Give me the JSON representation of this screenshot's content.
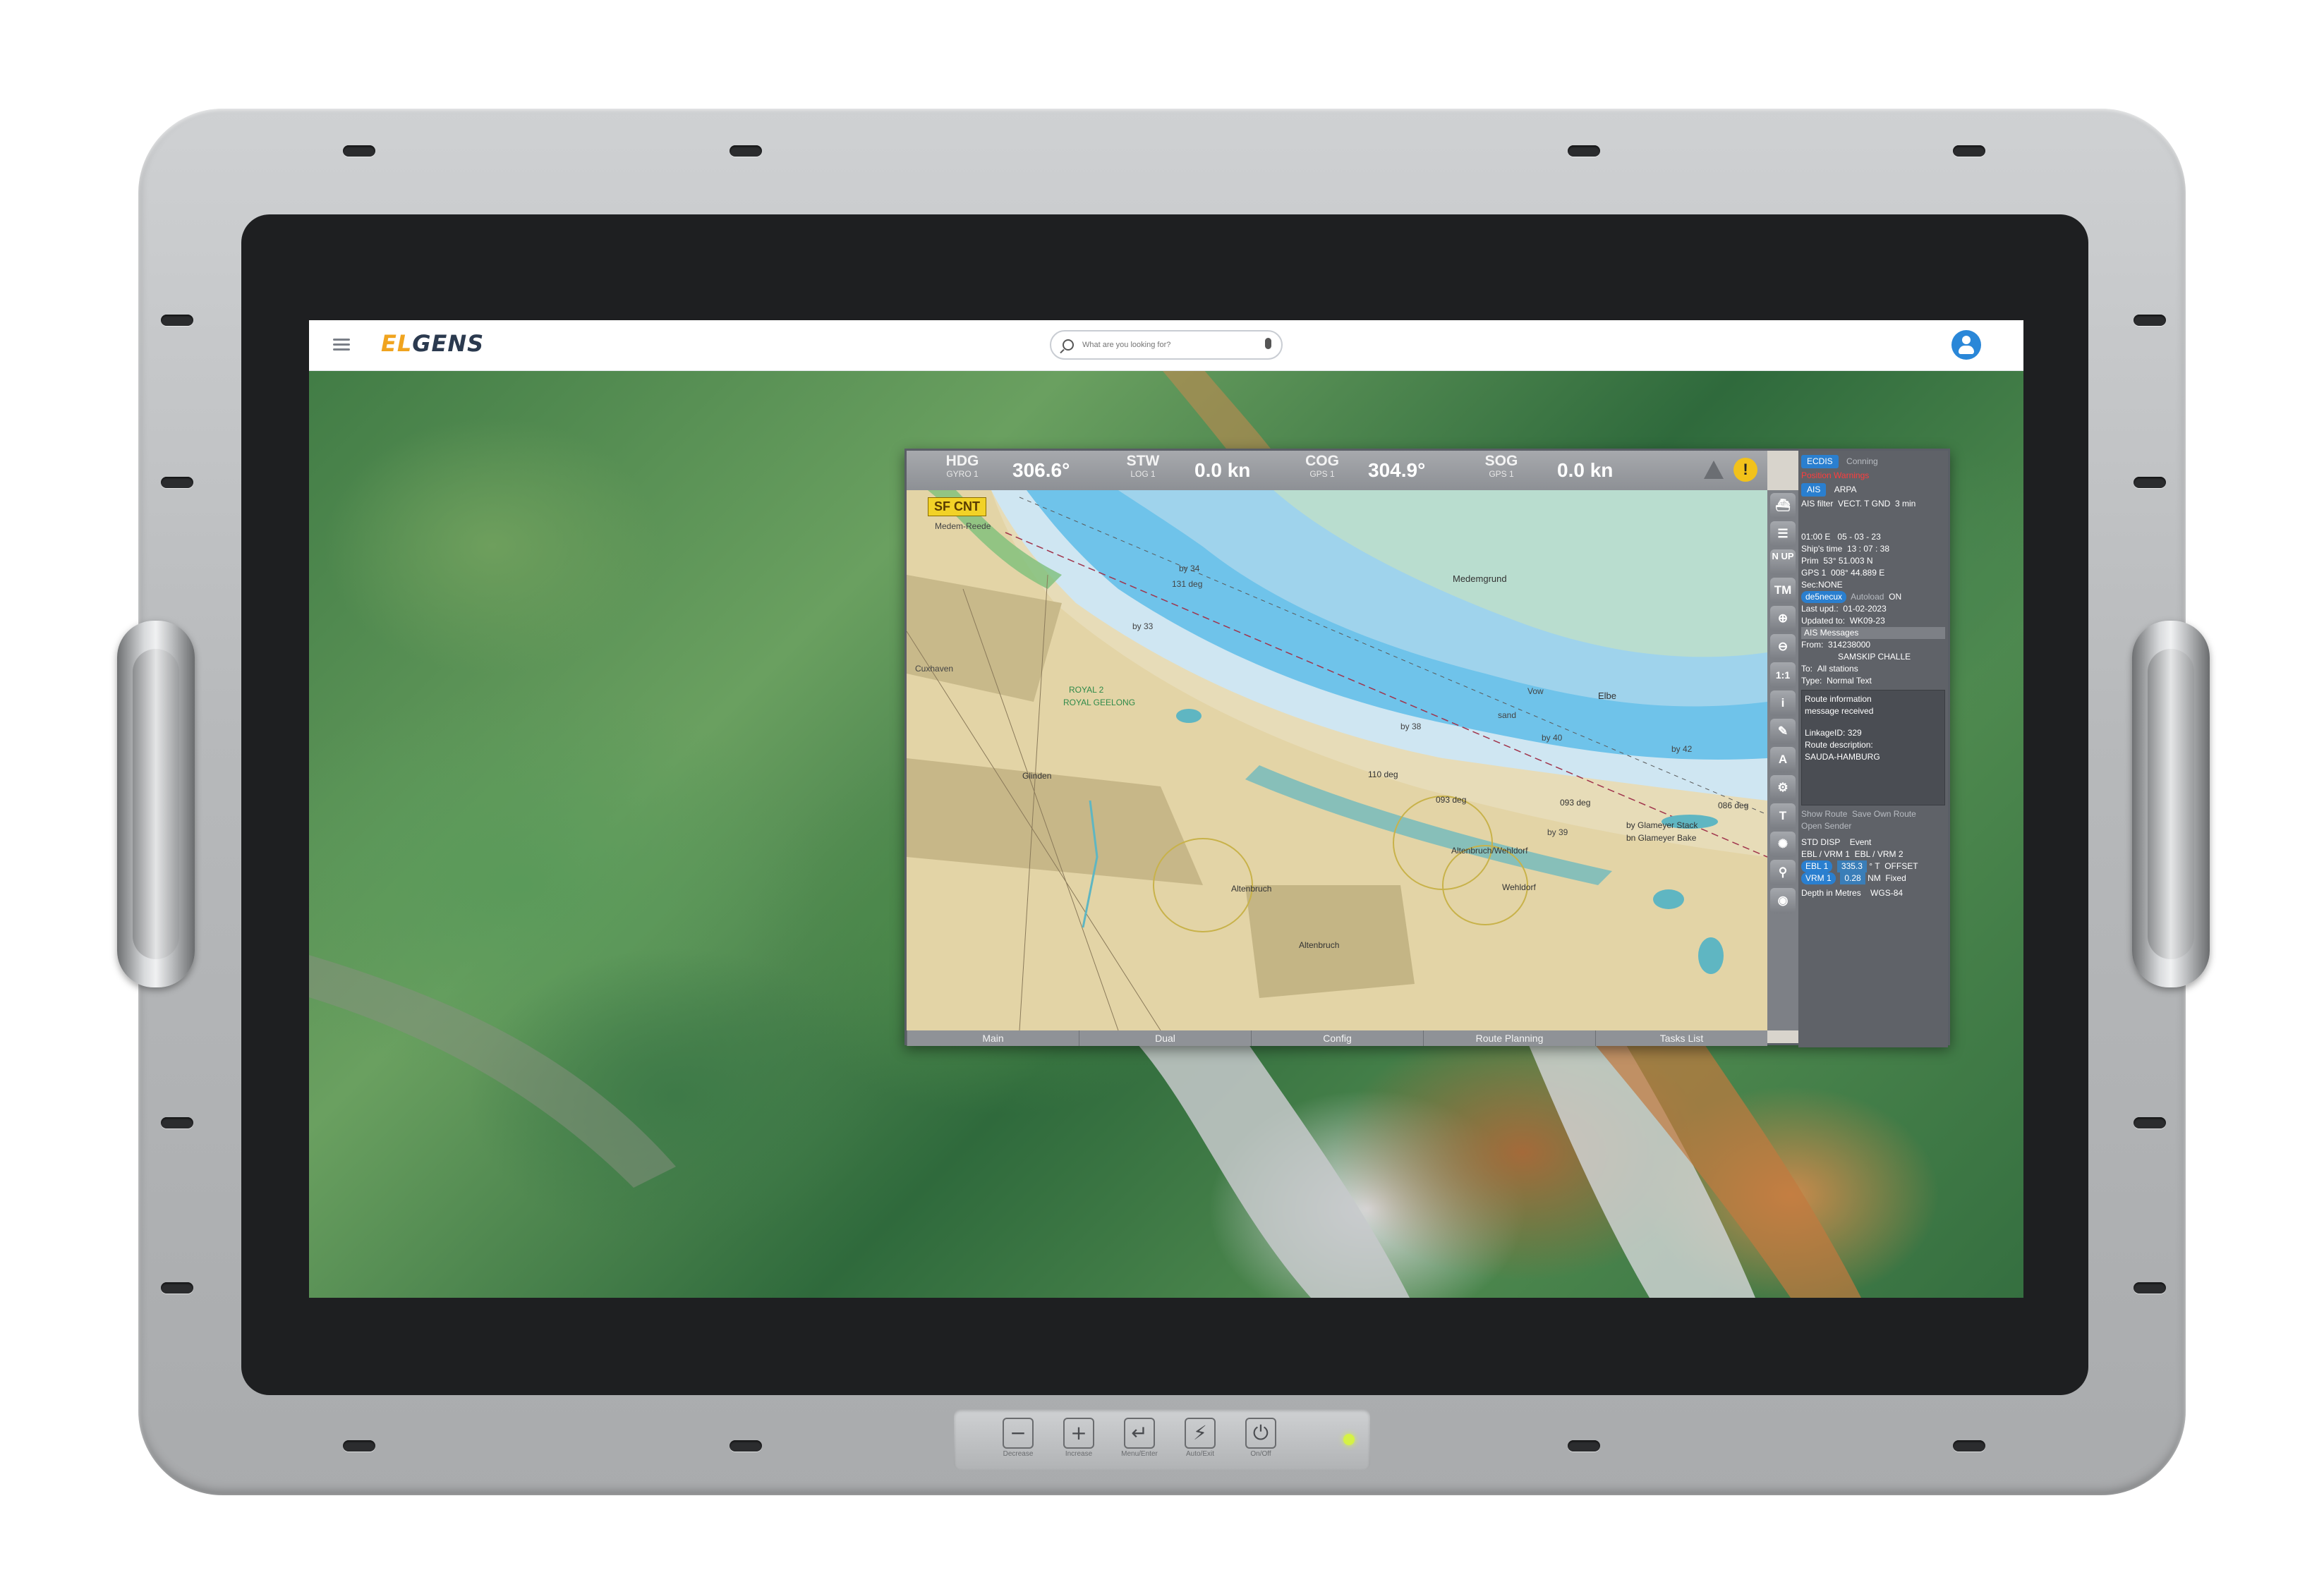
{
  "browser": {
    "logo_left": "EL",
    "logo_right": "GENS",
    "search_placeholder": "What are you looking for?"
  },
  "ecdis": {
    "header": [
      {
        "label": "HDG",
        "sub": "GYRO 1",
        "value": "306.6°"
      },
      {
        "label": "STW",
        "sub": "LOG 1",
        "value": "0.0 kn"
      },
      {
        "label": "COG",
        "sub": "GPS 1",
        "value": "304.9°"
      },
      {
        "label": "SOG",
        "sub": "GPS 1",
        "value": "0.0 kn"
      }
    ],
    "warn_label": "!",
    "sf_cnt": "SF CNT",
    "chart_labels": {
      "medemgrund": "Medemgrund",
      "cuxhaven": "Cuxhaven",
      "elbe": "Elbe",
      "vow": "Vow",
      "sand": "sand",
      "deg110": "110 deg",
      "deg093a": "093 deg",
      "deg093b": "093 deg",
      "deg131": "131 deg",
      "deg086": "086 deg",
      "by34": "by 34",
      "by33": "by 33",
      "by38": "by 38",
      "by40": "by 40",
      "by42": "by 42",
      "by39": "by 39",
      "glameyer_stack": "by Glameyer Stack",
      "glameyer_bake": "bn Glameyer Bake",
      "altenbruch_wehldorf": "Altenbruch/Wehldorf",
      "wehldorf": "Wehldorf",
      "altenbruch1": "Altenbruch",
      "altenbruch2": "Altenbruch",
      "glinden": "Glinden",
      "cuxhaven_reede": "Medem-Reede",
      "royal": "ROYAL 2",
      "geelong": "ROYAL GEELONG"
    },
    "bottom_tabs": [
      "Main",
      "Dual",
      "Config",
      "Route Planning",
      "Tasks List"
    ],
    "tools": [
      "⛴",
      "☰",
      "N UP",
      "TM",
      "⊕",
      "⊖",
      "1:1",
      "i",
      "✎",
      "A",
      "⚙",
      "T",
      "✺",
      "⚲",
      "◉"
    ],
    "side_panel": {
      "tab_ecdis": "ECDIS",
      "tab_conning": "Conning",
      "warning": "Position Warnings",
      "tab_ais": "AIS",
      "tab_arpa": "ARPA",
      "ais_filter": "AIS filter",
      "vect": "VECT. T GND",
      "vect_time": "3 min",
      "time": "01:00 E",
      "date": "05 - 03 - 23",
      "ships_time_label": "Ship's time",
      "ships_time": "13 : 07 : 38",
      "prim_label": "Prim",
      "lat": "53° 51.003 N",
      "gps_label": "GPS 1",
      "lon": "008° 44.889 E",
      "sec": "Sec:NONE",
      "depth_unit": "de5necux",
      "autoload": "Autoload",
      "on": "ON",
      "last_upd_label": "Last upd.:",
      "last_upd": "01-02-2023",
      "updated_to_label": "Updated to:",
      "updated_to": "WK09-23",
      "ais_messages": "AIS Messages",
      "from_label": "From:",
      "from_id": "314238000",
      "from_name": "SAMSKIP CHALLE",
      "to_label": "To:",
      "to": "All stations",
      "type_label": "Type:",
      "type": "Normal Text",
      "msg1": "Route information",
      "msg2": "message received",
      "msg3": "LinkageID: 329",
      "msg4": "Route description:",
      "msg5": "SAUDA-HAMBURG",
      "show_route": "Show Route",
      "save_own_route": "Save Own Route",
      "open_sender": "Open Sender",
      "std_disp": "STD DISP",
      "event": "Event",
      "ebl_vrm1": "EBL / VRM 1",
      "ebl_vrm2": "EBL / VRM 2",
      "ebl1": "EBL 1",
      "ebl1_val": "335.3",
      "ebl1_unit": "° T",
      "offset": "OFFSET",
      "vrm1": "VRM 1",
      "vrm1_val": "0.28",
      "vrm1_unit": "NM",
      "fixed": "Fixed",
      "depth_label": "Depth in Metres",
      "datum": "WGS-84"
    }
  },
  "controls": [
    {
      "symbol": "−",
      "label": "Decrease"
    },
    {
      "symbol": "+",
      "label": "Increase"
    },
    {
      "symbol": "↵",
      "label": "Menu/Enter"
    },
    {
      "symbol": "⚡",
      "label": "Auto/Exit"
    },
    {
      "symbol": "⏻",
      "label": "On/Off"
    }
  ]
}
